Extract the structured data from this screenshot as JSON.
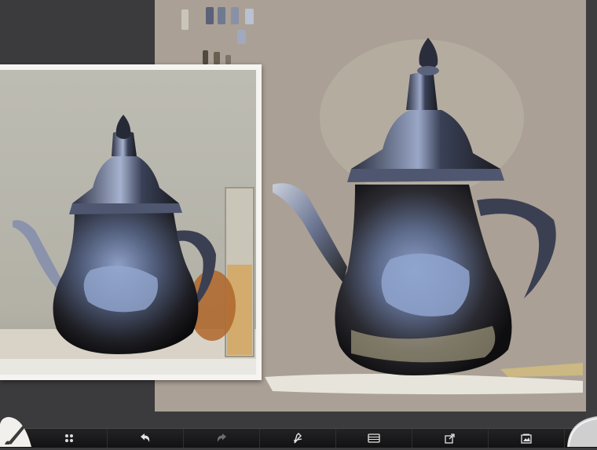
{
  "app": {
    "colors": {
      "background": "#3b3b3d",
      "canvas": "#aaa095",
      "reference_frame": "#f5f4f1",
      "toolbar": "#19191a"
    }
  },
  "palette": {
    "swatches": [
      {
        "name": "pale-gray",
        "color": "#c9c6b9"
      },
      {
        "name": "slate-blue",
        "color": "#5a6178"
      },
      {
        "name": "steel-blue",
        "color": "#6f7a92"
      },
      {
        "name": "blue-gray",
        "color": "#8891a6"
      },
      {
        "name": "pale-blue",
        "color": "#b9c1d2"
      },
      {
        "name": "light-blue",
        "color": "#a0a9bf"
      },
      {
        "name": "dark-brown",
        "color": "#514a40"
      },
      {
        "name": "brown",
        "color": "#6a6052"
      },
      {
        "name": "taupe",
        "color": "#7d7366"
      }
    ]
  },
  "toolbar": {
    "items": [
      {
        "name": "brush-corner",
        "icon": "brush-icon"
      },
      {
        "name": "settings",
        "icon": "gear-icon"
      },
      {
        "name": "undo",
        "icon": "undo-icon"
      },
      {
        "name": "redo",
        "icon": "redo-icon"
      },
      {
        "name": "brush-editor",
        "icon": "pen-icon"
      },
      {
        "name": "layers",
        "icon": "layers-icon"
      },
      {
        "name": "share",
        "icon": "share-icon"
      },
      {
        "name": "gallery",
        "icon": "gallery-icon"
      },
      {
        "name": "color-corner",
        "icon": "color-puck-icon"
      }
    ]
  }
}
